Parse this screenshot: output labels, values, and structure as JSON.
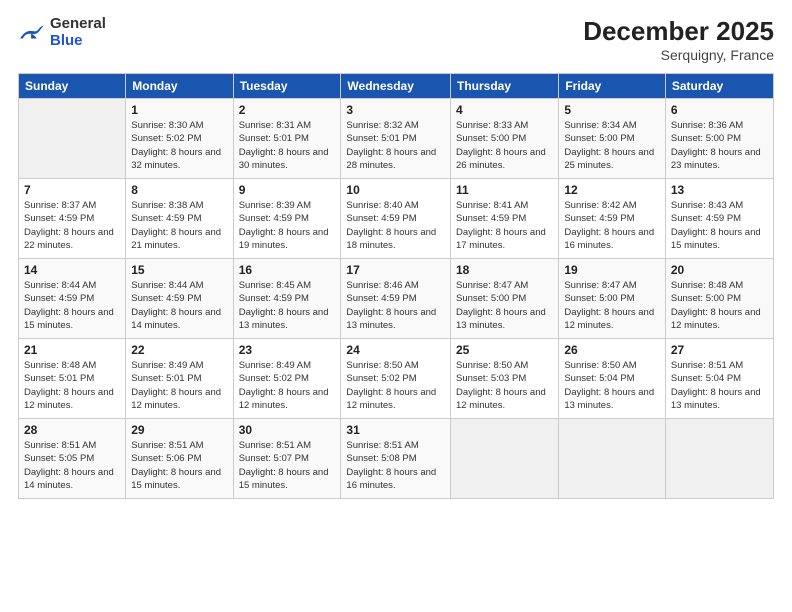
{
  "header": {
    "logo_general": "General",
    "logo_blue": "Blue",
    "title": "December 2025",
    "subtitle": "Serquigny, France"
  },
  "columns": [
    "Sunday",
    "Monday",
    "Tuesday",
    "Wednesday",
    "Thursday",
    "Friday",
    "Saturday"
  ],
  "weeks": [
    [
      {
        "day": "",
        "empty": true
      },
      {
        "day": "1",
        "sunrise": "Sunrise: 8:30 AM",
        "sunset": "Sunset: 5:02 PM",
        "daylight": "Daylight: 8 hours and 32 minutes."
      },
      {
        "day": "2",
        "sunrise": "Sunrise: 8:31 AM",
        "sunset": "Sunset: 5:01 PM",
        "daylight": "Daylight: 8 hours and 30 minutes."
      },
      {
        "day": "3",
        "sunrise": "Sunrise: 8:32 AM",
        "sunset": "Sunset: 5:01 PM",
        "daylight": "Daylight: 8 hours and 28 minutes."
      },
      {
        "day": "4",
        "sunrise": "Sunrise: 8:33 AM",
        "sunset": "Sunset: 5:00 PM",
        "daylight": "Daylight: 8 hours and 26 minutes."
      },
      {
        "day": "5",
        "sunrise": "Sunrise: 8:34 AM",
        "sunset": "Sunset: 5:00 PM",
        "daylight": "Daylight: 8 hours and 25 minutes."
      },
      {
        "day": "6",
        "sunrise": "Sunrise: 8:36 AM",
        "sunset": "Sunset: 5:00 PM",
        "daylight": "Daylight: 8 hours and 23 minutes."
      }
    ],
    [
      {
        "day": "7",
        "sunrise": "Sunrise: 8:37 AM",
        "sunset": "Sunset: 4:59 PM",
        "daylight": "Daylight: 8 hours and 22 minutes."
      },
      {
        "day": "8",
        "sunrise": "Sunrise: 8:38 AM",
        "sunset": "Sunset: 4:59 PM",
        "daylight": "Daylight: 8 hours and 21 minutes."
      },
      {
        "day": "9",
        "sunrise": "Sunrise: 8:39 AM",
        "sunset": "Sunset: 4:59 PM",
        "daylight": "Daylight: 8 hours and 19 minutes."
      },
      {
        "day": "10",
        "sunrise": "Sunrise: 8:40 AM",
        "sunset": "Sunset: 4:59 PM",
        "daylight": "Daylight: 8 hours and 18 minutes."
      },
      {
        "day": "11",
        "sunrise": "Sunrise: 8:41 AM",
        "sunset": "Sunset: 4:59 PM",
        "daylight": "Daylight: 8 hours and 17 minutes."
      },
      {
        "day": "12",
        "sunrise": "Sunrise: 8:42 AM",
        "sunset": "Sunset: 4:59 PM",
        "daylight": "Daylight: 8 hours and 16 minutes."
      },
      {
        "day": "13",
        "sunrise": "Sunrise: 8:43 AM",
        "sunset": "Sunset: 4:59 PM",
        "daylight": "Daylight: 8 hours and 15 minutes."
      }
    ],
    [
      {
        "day": "14",
        "sunrise": "Sunrise: 8:44 AM",
        "sunset": "Sunset: 4:59 PM",
        "daylight": "Daylight: 8 hours and 15 minutes."
      },
      {
        "day": "15",
        "sunrise": "Sunrise: 8:44 AM",
        "sunset": "Sunset: 4:59 PM",
        "daylight": "Daylight: 8 hours and 14 minutes."
      },
      {
        "day": "16",
        "sunrise": "Sunrise: 8:45 AM",
        "sunset": "Sunset: 4:59 PM",
        "daylight": "Daylight: 8 hours and 13 minutes."
      },
      {
        "day": "17",
        "sunrise": "Sunrise: 8:46 AM",
        "sunset": "Sunset: 4:59 PM",
        "daylight": "Daylight: 8 hours and 13 minutes."
      },
      {
        "day": "18",
        "sunrise": "Sunrise: 8:47 AM",
        "sunset": "Sunset: 5:00 PM",
        "daylight": "Daylight: 8 hours and 13 minutes."
      },
      {
        "day": "19",
        "sunrise": "Sunrise: 8:47 AM",
        "sunset": "Sunset: 5:00 PM",
        "daylight": "Daylight: 8 hours and 12 minutes."
      },
      {
        "day": "20",
        "sunrise": "Sunrise: 8:48 AM",
        "sunset": "Sunset: 5:00 PM",
        "daylight": "Daylight: 8 hours and 12 minutes."
      }
    ],
    [
      {
        "day": "21",
        "sunrise": "Sunrise: 8:48 AM",
        "sunset": "Sunset: 5:01 PM",
        "daylight": "Daylight: 8 hours and 12 minutes."
      },
      {
        "day": "22",
        "sunrise": "Sunrise: 8:49 AM",
        "sunset": "Sunset: 5:01 PM",
        "daylight": "Daylight: 8 hours and 12 minutes."
      },
      {
        "day": "23",
        "sunrise": "Sunrise: 8:49 AM",
        "sunset": "Sunset: 5:02 PM",
        "daylight": "Daylight: 8 hours and 12 minutes."
      },
      {
        "day": "24",
        "sunrise": "Sunrise: 8:50 AM",
        "sunset": "Sunset: 5:02 PM",
        "daylight": "Daylight: 8 hours and 12 minutes."
      },
      {
        "day": "25",
        "sunrise": "Sunrise: 8:50 AM",
        "sunset": "Sunset: 5:03 PM",
        "daylight": "Daylight: 8 hours and 12 minutes."
      },
      {
        "day": "26",
        "sunrise": "Sunrise: 8:50 AM",
        "sunset": "Sunset: 5:04 PM",
        "daylight": "Daylight: 8 hours and 13 minutes."
      },
      {
        "day": "27",
        "sunrise": "Sunrise: 8:51 AM",
        "sunset": "Sunset: 5:04 PM",
        "daylight": "Daylight: 8 hours and 13 minutes."
      }
    ],
    [
      {
        "day": "28",
        "sunrise": "Sunrise: 8:51 AM",
        "sunset": "Sunset: 5:05 PM",
        "daylight": "Daylight: 8 hours and 14 minutes."
      },
      {
        "day": "29",
        "sunrise": "Sunrise: 8:51 AM",
        "sunset": "Sunset: 5:06 PM",
        "daylight": "Daylight: 8 hours and 15 minutes."
      },
      {
        "day": "30",
        "sunrise": "Sunrise: 8:51 AM",
        "sunset": "Sunset: 5:07 PM",
        "daylight": "Daylight: 8 hours and 15 minutes."
      },
      {
        "day": "31",
        "sunrise": "Sunrise: 8:51 AM",
        "sunset": "Sunset: 5:08 PM",
        "daylight": "Daylight: 8 hours and 16 minutes."
      },
      {
        "day": "",
        "empty": true
      },
      {
        "day": "",
        "empty": true
      },
      {
        "day": "",
        "empty": true
      }
    ]
  ]
}
